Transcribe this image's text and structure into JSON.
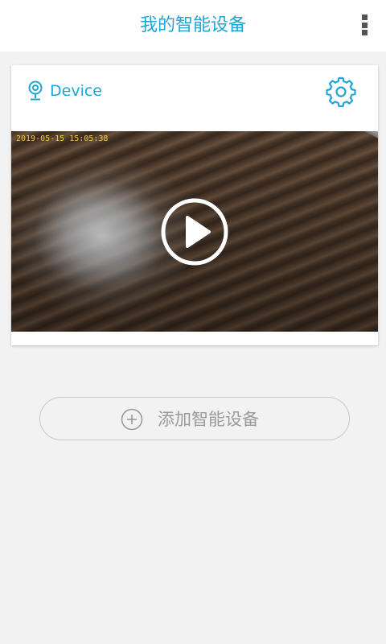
{
  "header": {
    "title": "我的智能设备",
    "menu_icon": "more-vertical-icon"
  },
  "device_card": {
    "icon": "webcam-icon",
    "name": "Device",
    "settings_icon": "gear-icon",
    "video": {
      "timestamp": "2019-05-15 15:05:38",
      "play_icon": "play-circle-icon"
    }
  },
  "add_device": {
    "icon": "plus-circle-icon",
    "label": "添加智能设备"
  },
  "colors": {
    "accent": "#1fa5d6",
    "background": "#f2f2f2",
    "muted_text": "#9a9a9a"
  }
}
